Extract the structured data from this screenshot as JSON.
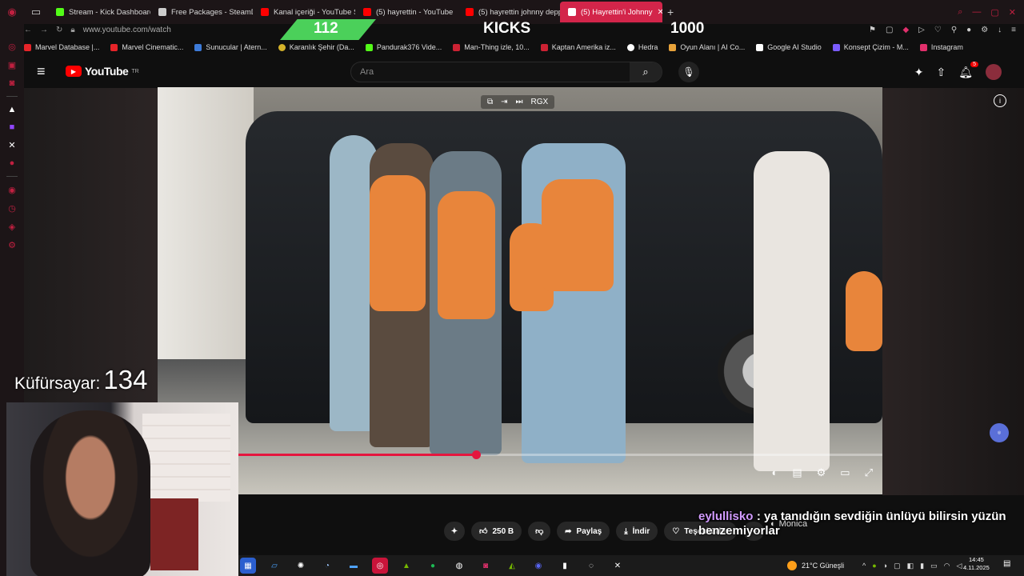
{
  "browser": {
    "tabs": [
      {
        "label": "Stream - Kick Dashboard",
        "color": "#53fc18"
      },
      {
        "label": "Free Packages - SteamDB",
        "color": "#cccccc"
      },
      {
        "label": "Kanal içeriği - YouTube S",
        "color": "#ff0000"
      },
      {
        "label": "(5) hayrettin - YouTube",
        "color": "#ff0000"
      },
      {
        "label": "(5) hayrettin johnny depp",
        "color": "#ff0000"
      },
      {
        "label": "(5) Hayrettin'i Johnny",
        "color": "#ff0000",
        "active": true
      }
    ],
    "url": "www.youtube.com/watch",
    "bookmarks": [
      {
        "label": "Marvel Database |...",
        "color": "#e62429"
      },
      {
        "label": "Marvel Cinematic...",
        "color": "#e62429"
      },
      {
        "label": "Sunucular | Atern...",
        "color": "#3d7bd9"
      },
      {
        "label": "Karanlık Şehir (Da...",
        "color": "#d4b22a"
      },
      {
        "label": "Pandurak376 Vide...",
        "color": "#53fc18"
      },
      {
        "label": "Man-Thing izle, 10...",
        "color": "#cc2233"
      },
      {
        "label": "Kaptan Amerika iz...",
        "color": "#cc2233"
      },
      {
        "label": "Hedra",
        "color": "#ffffff"
      },
      {
        "label": "Oyun Alanı | AI Co...",
        "color": "#e8a33a"
      },
      {
        "label": "Google AI Studio",
        "color": "#ffffff"
      },
      {
        "label": "Konsept Çizim - M...",
        "color": "#7b5cff"
      },
      {
        "label": "Instagram",
        "color": "#e1306c"
      }
    ]
  },
  "stream_overlay": {
    "left_count": "112",
    "center_label": "KICKS",
    "right_count": "1000",
    "accent": "#4bd05a"
  },
  "youtube": {
    "logo_text": "YouTube",
    "region": "TR",
    "search_placeholder": "Ara",
    "notifications": "5",
    "video_progress_fraction": 0.37,
    "video_controls_top": [
      "pip-icon",
      "skip-icon",
      "next-icon",
      "RGX"
    ],
    "actions": {
      "likes": "250 B",
      "share": "Paylaş",
      "download": "İndir",
      "thanks": "Teşekkürler"
    }
  },
  "swear_counter": {
    "label": "Küfürsayar:",
    "value": "134"
  },
  "chat": {
    "user": "eylullisko",
    "message": ": ya tanıdığın sevdiğin ünlüyü bilirsin yüzün benzemiyorlar"
  },
  "monica": "Monica",
  "taskbar": {
    "weather": "21°C  Güneşli",
    "time": "14:45",
    "date": "4.11.2025"
  }
}
